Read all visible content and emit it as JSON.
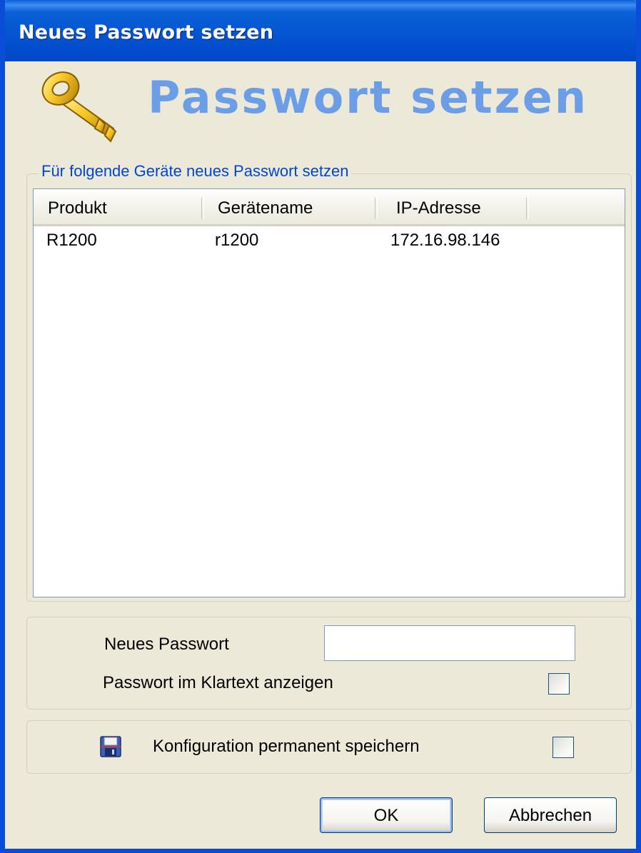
{
  "window": {
    "title": "Neues Passwort setzen",
    "accent_color": "#0a4ed8"
  },
  "banner": {
    "title": "Passwort setzen",
    "icon": "key-icon",
    "title_color": "#6b9ee6"
  },
  "devices_group": {
    "legend": "Für folgende Geräte neues Passwort setzen",
    "columns": [
      "Produkt",
      "Gerätename",
      "IP-Adresse"
    ],
    "rows": [
      [
        "R1200",
        "r1200",
        "172.16.98.146"
      ]
    ]
  },
  "password_group": {
    "new_password_label": "Neues Passwort",
    "new_password_value": "",
    "show_plaintext_label": "Passwort im Klartext anzeigen",
    "show_plaintext_checked": false
  },
  "save_group": {
    "icon": "floppy-disk-icon",
    "save_label": "Konfiguration permanent speichern",
    "save_checked": false
  },
  "buttons": {
    "ok": "OK",
    "cancel": "Abbrechen"
  }
}
